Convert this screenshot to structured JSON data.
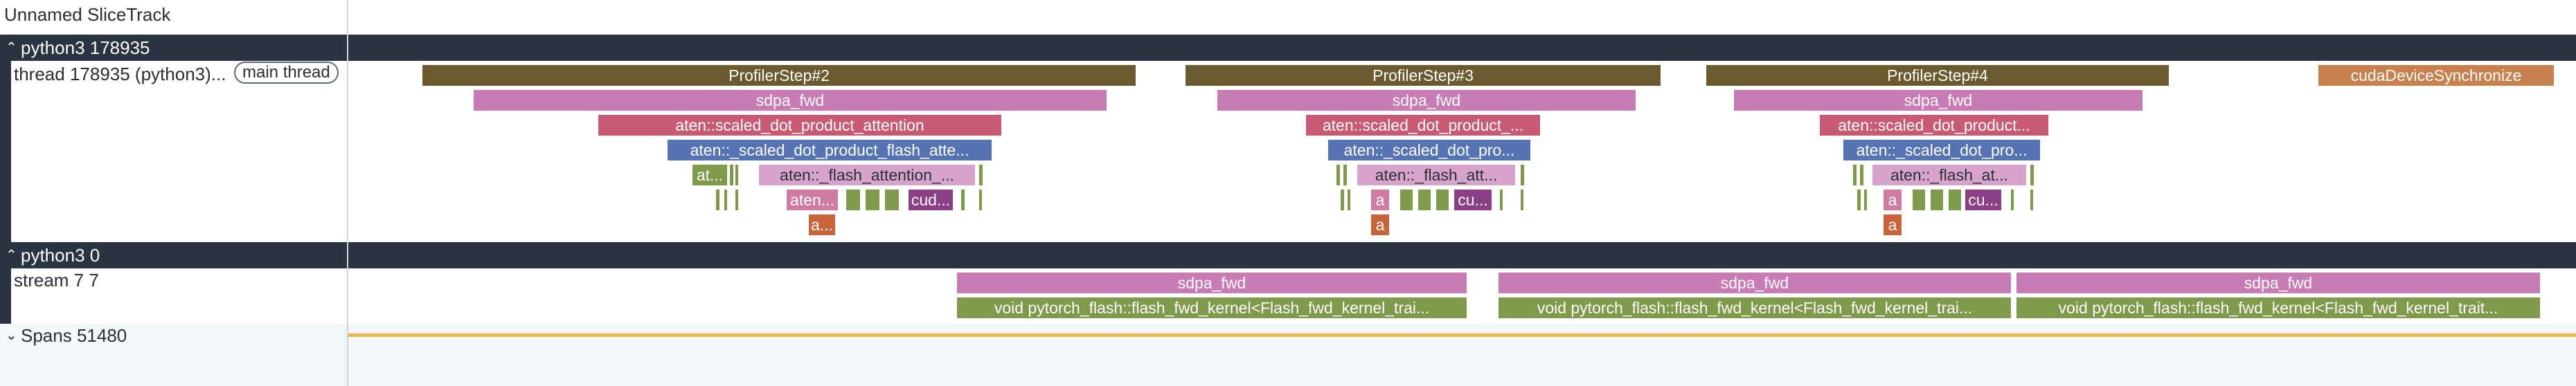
{
  "tracks": {
    "unnamed": "Unnamed SliceTrack",
    "python_proc": "python3 178935",
    "thread": "thread 178935 (python3)...",
    "thread_badge": "main thread",
    "python0": "python3 0",
    "stream": "stream 7 7",
    "spans": "Spans 51480"
  },
  "icons": {
    "expanded": "chevron-up-icon",
    "collapsed": "chevron-down-icon"
  },
  "thread_slices": {
    "step2": "ProfilerStep#2",
    "step3": "ProfilerStep#3",
    "step4": "ProfilerStep#4",
    "sync": "cudaDeviceSynchronize",
    "sdpa": "sdpa_fwd",
    "attn_full": "aten::scaled_dot_product_attention",
    "attn_short1": "aten::scaled_dot_product_...",
    "attn_short2": "aten::scaled_dot_product...",
    "flash_long": "aten::_scaled_dot_product_flash_atte...",
    "flash_short": "aten::_scaled_dot_pro...",
    "flash_attn": "aten::_flash_attention_...",
    "flash_attn_s": "aten::_flash_att...",
    "flash_attn_s2": "aten::_flash_at...",
    "at": "at...",
    "aten_short": "aten...",
    "cud": "cud...",
    "cu": "cu...",
    "a_ellipsis": "a...",
    "a": "a"
  },
  "stream_slices": {
    "sdpa": "sdpa_fwd",
    "kernel1": "void pytorch_flash::flash_fwd_kernel<Flash_fwd_kernel_trai...",
    "kernel2": "void pytorch_flash::flash_fwd_kernel<Flash_fwd_kernel_trai...",
    "kernel3": "void pytorch_flash::flash_fwd_kernel<Flash_fwd_kernel_trait..."
  },
  "colors": {
    "profiler_step": "#6b5a2e",
    "sdpa": "#c97bb4",
    "scaled_dot": "#c85a73",
    "flash": "#5674b3",
    "flash_attention": "#d6a4cc",
    "green": "#7f9a4a",
    "purple": "#8a3f86",
    "orange": "#c9643a",
    "sync": "#c7804e",
    "track_header": "#2a3440",
    "spans_line": "#e8b84a"
  }
}
